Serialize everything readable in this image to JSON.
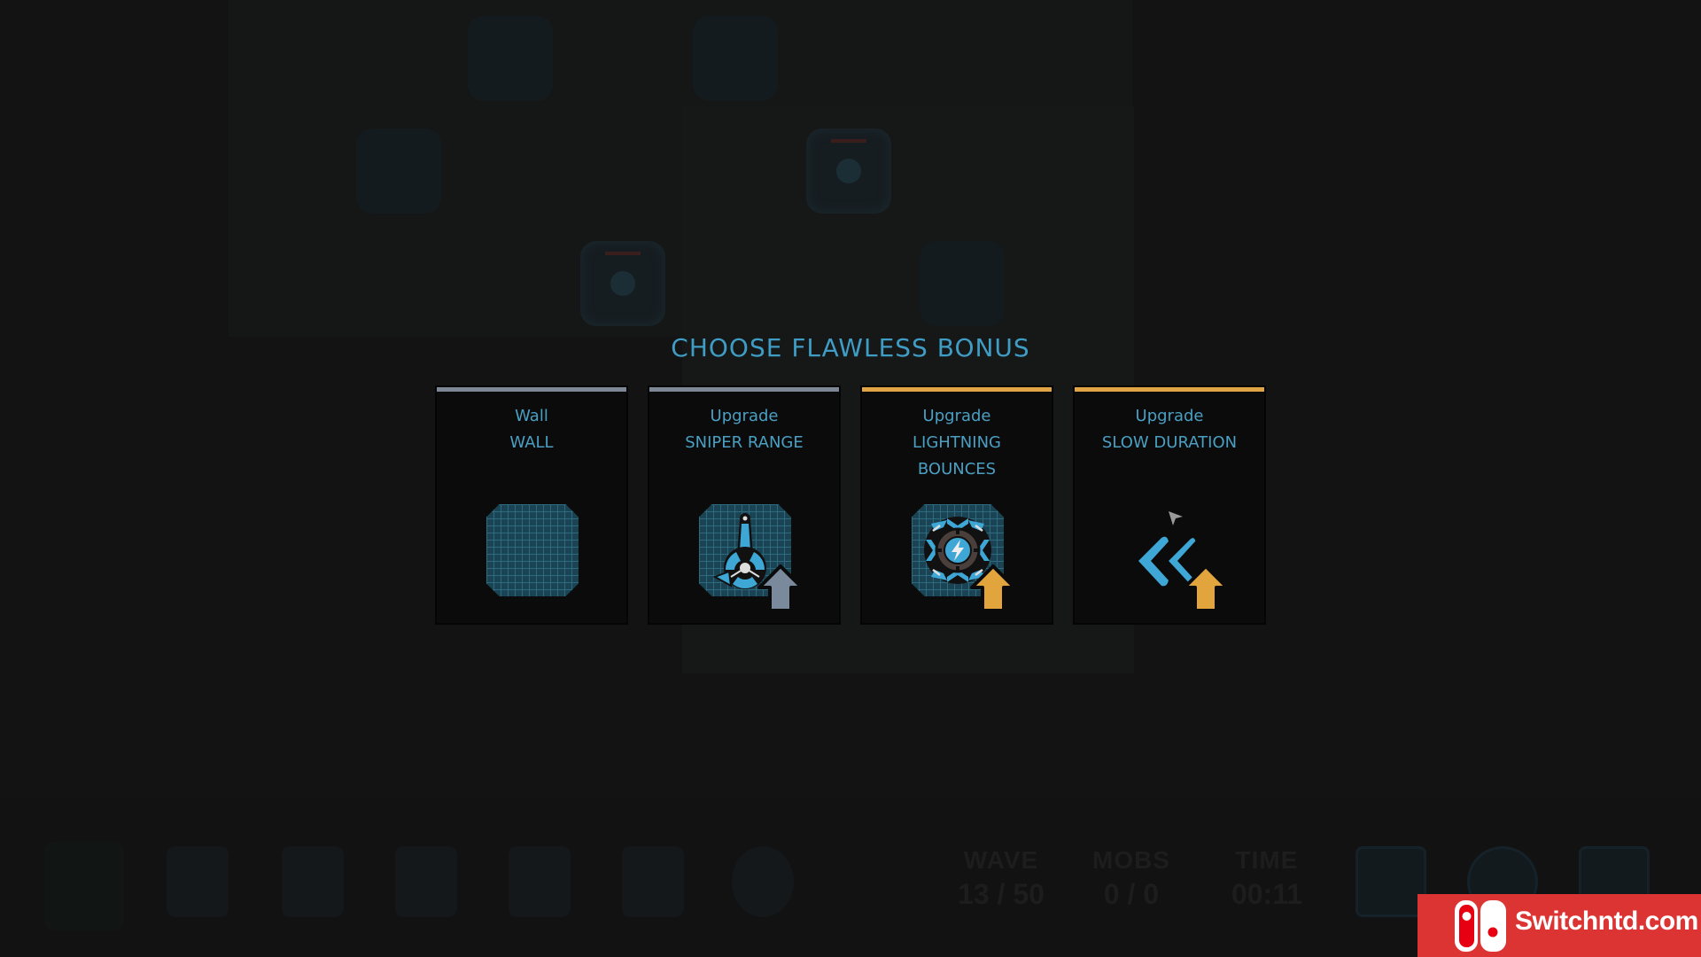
{
  "dialog": {
    "title": "CHOOSE FLAWLESS BONUS",
    "cards": [
      {
        "kind": "Wall",
        "lines": [
          "WALL"
        ],
        "rarity": "common",
        "rarity_color": "#7d8796",
        "icon": "wall-tile-icon",
        "upgrade_arrow": false
      },
      {
        "kind": "Upgrade",
        "lines": [
          "SNIPER RANGE"
        ],
        "rarity": "common",
        "rarity_color": "#7d8796",
        "icon": "sniper-tower-icon",
        "upgrade_arrow": true,
        "arrow_color": "#7a8a9c"
      },
      {
        "kind": "Upgrade",
        "lines": [
          "LIGHTNING",
          "BOUNCES"
        ],
        "rarity": "rare",
        "rarity_color": "#e0a444",
        "icon": "lightning-tower-icon",
        "upgrade_arrow": true,
        "arrow_color": "#e2a43c"
      },
      {
        "kind": "Upgrade",
        "lines": [
          "SLOW DURATION"
        ],
        "rarity": "rare",
        "rarity_color": "#e0a444",
        "icon": "slow-chevrons-icon",
        "upgrade_arrow": true,
        "arrow_color": "#e2a43c"
      }
    ]
  },
  "hud": {
    "wave_label": "WAVE",
    "wave_value": "13 / 50",
    "mobs_label": "MOBS",
    "mobs_value": "0 / 0",
    "time_label": "TIME",
    "time_value": "00:11",
    "buttons": [
      "list-icon",
      "help-icon",
      "settings-gear-icon"
    ]
  },
  "watermark": {
    "text": "Switchntd.com"
  },
  "colors": {
    "accent_blue": "#3f9cc4",
    "text_blue": "#4a9fc3",
    "common_gray": "#7d8796",
    "rare_gold": "#e0a444",
    "background": "#131313",
    "card_bg": "#0b0b0b"
  }
}
